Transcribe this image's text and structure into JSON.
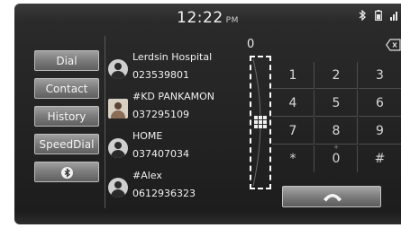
{
  "status": {
    "time": "12:22",
    "ampm": "PM",
    "icons": [
      "bluetooth-icon",
      "battery-icon",
      "signal-icon"
    ]
  },
  "menu": {
    "items": [
      {
        "label": "Dial"
      },
      {
        "label": "Contact"
      },
      {
        "label": "History"
      },
      {
        "label": "SpeedDial"
      }
    ],
    "bluetooth_button_icon": "bluetooth-icon"
  },
  "contacts": [
    {
      "name": "Lerdsin Hospital",
      "number": "023539801",
      "avatar": "person-icon"
    },
    {
      "name": "#KD PANKAMON",
      "number": "037295109",
      "avatar": "photo"
    },
    {
      "name": "HOME",
      "number": "037407034",
      "avatar": "person-icon"
    },
    {
      "name": "#Alex",
      "number": "0612936323",
      "avatar": "person-icon"
    }
  ],
  "dialer": {
    "number": "0",
    "delete_icon": "backspace-icon",
    "handle_icon": "grid-icon",
    "keys": [
      {
        "main": "1",
        "sub": ""
      },
      {
        "main": "2",
        "sub": ""
      },
      {
        "main": "3",
        "sub": ""
      },
      {
        "main": "4",
        "sub": ""
      },
      {
        "main": "5",
        "sub": ""
      },
      {
        "main": "6",
        "sub": ""
      },
      {
        "main": "7",
        "sub": ""
      },
      {
        "main": "8",
        "sub": ""
      },
      {
        "main": "9",
        "sub": ""
      },
      {
        "main": "*",
        "sub": ""
      },
      {
        "main": "0",
        "sub": "+"
      },
      {
        "main": "#",
        "sub": ""
      }
    ],
    "call_icon": "phone-icon"
  },
  "colors": {
    "background": "#242424",
    "button": "#7e7e7e",
    "text": "#f0f0f0"
  }
}
